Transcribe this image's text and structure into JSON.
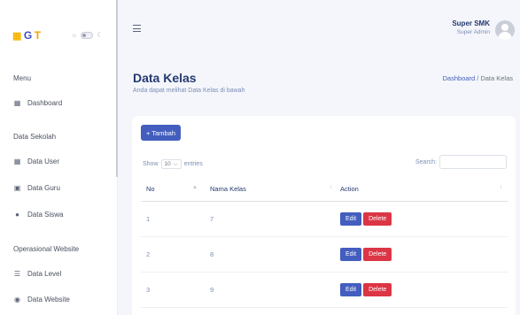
{
  "brand": {
    "logo_text_g": "G",
    "logo_text_t": "T"
  },
  "sidebar": {
    "sections": [
      {
        "label": "Menu"
      },
      {
        "label": "Data Sekolah"
      },
      {
        "label": "Operasional Website"
      }
    ],
    "items": [
      {
        "label": "Dashboard",
        "icon": "grid-icon"
      },
      {
        "label": "Data User",
        "icon": "table-icon"
      },
      {
        "label": "Data Guru",
        "icon": "chalkboard-icon"
      },
      {
        "label": "Data Siswa",
        "icon": "people-icon"
      },
      {
        "label": "Data Level",
        "icon": "layers-icon"
      },
      {
        "label": "Data Website",
        "icon": "globe-icon"
      }
    ]
  },
  "header": {
    "user_name": "Super SMK",
    "user_role": "Super Admin"
  },
  "page": {
    "title": "Data Kelas",
    "subtitle": "Anda dapat melihat Data Kelas di bawah",
    "breadcrumb": {
      "home": "Dashboard",
      "separator": "/",
      "current": "Data Kelas"
    }
  },
  "toolbar": {
    "add_label": "+ Tambah"
  },
  "table_controls": {
    "show_label": "Show",
    "entries_value": "10",
    "entries_label": "entries",
    "search_label": "Search:",
    "search_value": ""
  },
  "table": {
    "headers": [
      "No",
      "Nama Kelas",
      "Action"
    ],
    "rows": [
      {
        "no": "1",
        "nama": "7"
      },
      {
        "no": "2",
        "nama": "8"
      },
      {
        "no": "3",
        "nama": "9"
      }
    ],
    "edit_label": "Edit",
    "delete_label": "Delete"
  },
  "colors": {
    "primary": "#435ebe",
    "danger": "#dc3545",
    "title": "#25396f"
  }
}
